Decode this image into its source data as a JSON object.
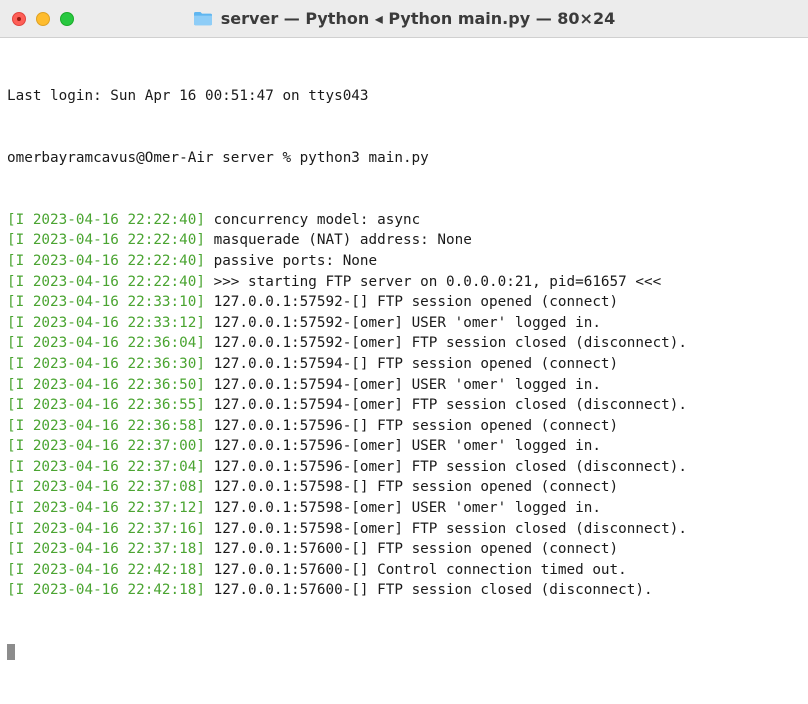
{
  "window": {
    "title": "server — Python ◂ Python main.py — 80×24",
    "icon": "folder-icon"
  },
  "terminal": {
    "last_login": "Last login: Sun Apr 16 00:51:47 on ttys043",
    "prompt": "omerbayramcavus@Omer-Air server % python3 main.py",
    "log_lines": [
      {
        "ts": "[I 2023-04-16 22:22:40]",
        "msg": " concurrency model: async"
      },
      {
        "ts": "[I 2023-04-16 22:22:40]",
        "msg": " masquerade (NAT) address: None"
      },
      {
        "ts": "[I 2023-04-16 22:22:40]",
        "msg": " passive ports: None"
      },
      {
        "ts": "[I 2023-04-16 22:22:40]",
        "msg": " >>> starting FTP server on 0.0.0.0:21, pid=61657 <<<"
      },
      {
        "ts": "[I 2023-04-16 22:33:10]",
        "msg": " 127.0.0.1:57592-[] FTP session opened (connect)"
      },
      {
        "ts": "[I 2023-04-16 22:33:12]",
        "msg": " 127.0.0.1:57592-[omer] USER 'omer' logged in."
      },
      {
        "ts": "[I 2023-04-16 22:36:04]",
        "msg": " 127.0.0.1:57592-[omer] FTP session closed (disconnect)."
      },
      {
        "ts": "[I 2023-04-16 22:36:30]",
        "msg": " 127.0.0.1:57594-[] FTP session opened (connect)"
      },
      {
        "ts": "[I 2023-04-16 22:36:50]",
        "msg": " 127.0.0.1:57594-[omer] USER 'omer' logged in."
      },
      {
        "ts": "[I 2023-04-16 22:36:55]",
        "msg": " 127.0.0.1:57594-[omer] FTP session closed (disconnect)."
      },
      {
        "ts": "[I 2023-04-16 22:36:58]",
        "msg": " 127.0.0.1:57596-[] FTP session opened (connect)"
      },
      {
        "ts": "[I 2023-04-16 22:37:00]",
        "msg": " 127.0.0.1:57596-[omer] USER 'omer' logged in."
      },
      {
        "ts": "[I 2023-04-16 22:37:04]",
        "msg": " 127.0.0.1:57596-[omer] FTP session closed (disconnect)."
      },
      {
        "ts": "[I 2023-04-16 22:37:08]",
        "msg": " 127.0.0.1:57598-[] FTP session opened (connect)"
      },
      {
        "ts": "[I 2023-04-16 22:37:12]",
        "msg": " 127.0.0.1:57598-[omer] USER 'omer' logged in."
      },
      {
        "ts": "[I 2023-04-16 22:37:16]",
        "msg": " 127.0.0.1:57598-[omer] FTP session closed (disconnect)."
      },
      {
        "ts": "[I 2023-04-16 22:37:18]",
        "msg": " 127.0.0.1:57600-[] FTP session opened (connect)"
      },
      {
        "ts": "[I 2023-04-16 22:42:18]",
        "msg": " 127.0.0.1:57600-[] Control connection timed out."
      },
      {
        "ts": "[I 2023-04-16 22:42:18]",
        "msg": " 127.0.0.1:57600-[] FTP session closed (disconnect)."
      }
    ]
  },
  "colors": {
    "timestamp": "#4aa431",
    "text": "#1a1a1a",
    "titlebar": "#ececec",
    "cursor": "#8c8c8c"
  }
}
